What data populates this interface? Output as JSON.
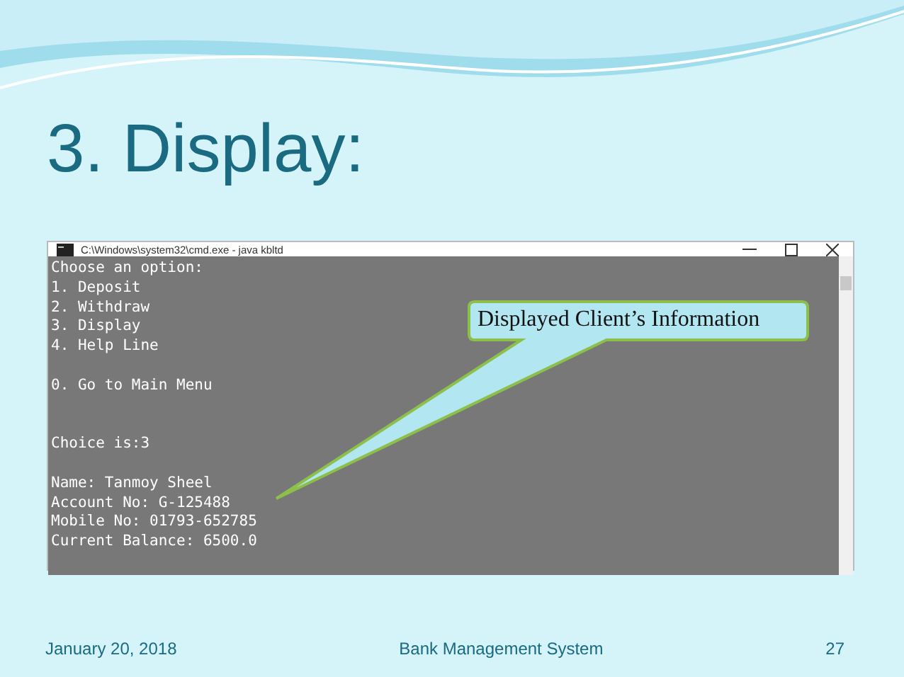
{
  "slide": {
    "title": "3. Display:"
  },
  "console_window": {
    "title": "C:\\Windows\\system32\\cmd.exe - java  kbltd",
    "blocks": [
      [
        "Choose an option:",
        "1. Deposit",
        "2. Withdraw",
        "3. Display",
        "4. Help Line"
      ],
      [
        "0. Go to Main Menu"
      ],
      [
        "Choice is:3"
      ],
      [
        "Name: Tanmoy Sheel",
        "Account No: G-125488",
        "Mobile No: 01793-652785",
        "Current Balance: 6500.0"
      ]
    ]
  },
  "callout": {
    "text": "Displayed Client’s Information"
  },
  "footer": {
    "date": "January 20, 2018",
    "center": "Bank Management System",
    "page": "27"
  }
}
